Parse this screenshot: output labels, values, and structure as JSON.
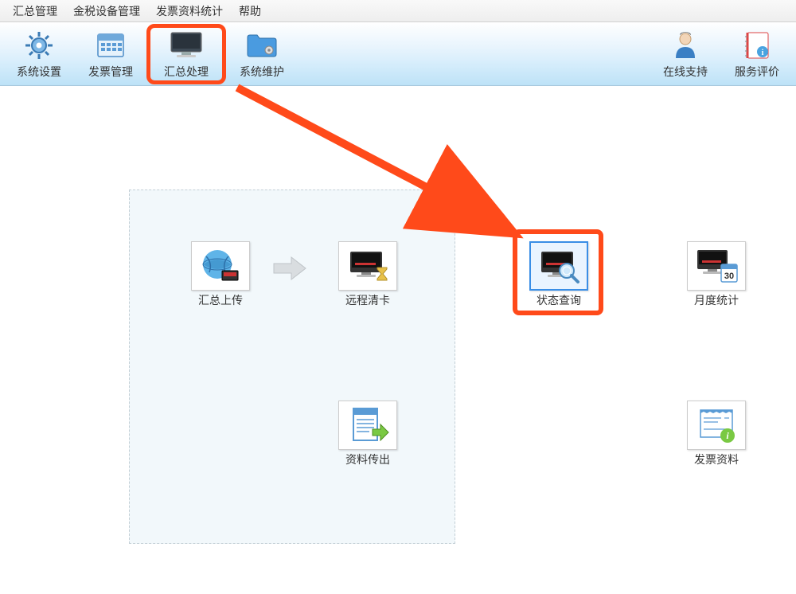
{
  "menu": {
    "items": [
      "汇总管理",
      "金税设备管理",
      "发票资料统计",
      "帮助"
    ]
  },
  "toolbar": {
    "left": [
      {
        "label": "系统设置"
      },
      {
        "label": "发票管理"
      },
      {
        "label": "汇总处理"
      },
      {
        "label": "系统维护"
      }
    ],
    "right": [
      {
        "label": "在线支持"
      },
      {
        "label": "服务评价"
      }
    ]
  },
  "content": {
    "group_icons": {
      "upload": "汇总上传",
      "remote_clear": "远程清卡",
      "export": "资料传出"
    },
    "right_icons": {
      "status_query": "状态查询",
      "monthly_stats": "月度统计",
      "invoice_data": "发票资料"
    },
    "calendar_day": "30"
  },
  "colors": {
    "highlight": "#ff4a1a",
    "toolbar_gradient_top": "#ffffff",
    "toolbar_gradient_bottom": "#bde2f7"
  }
}
